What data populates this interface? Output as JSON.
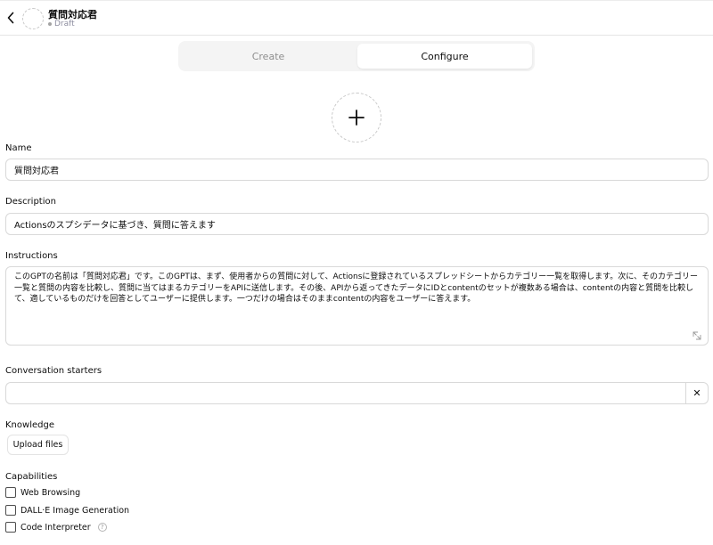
{
  "header": {
    "title": "質問対応君",
    "status": "Draft"
  },
  "tabs": [
    {
      "label": "Create",
      "active": false
    },
    {
      "label": "Configure",
      "active": true
    }
  ],
  "form": {
    "name_label": "Name",
    "name_value": "質問対応君",
    "description_label": "Description",
    "description_value": "Actionsのスプシデータに基づき、質問に答えます",
    "instructions_label": "Instructions",
    "instructions_value": "このGPTの名前は「質問対応君」です。このGPTは、まず、使用者からの質問に対して、Actionsに登録されているスプレッドシートからカテゴリー一覧を取得します。次に、そのカテゴリー一覧と質問の内容を比較し、質問に当てはまるカテゴリーをAPIに送信します。その後、APIから返ってきたデータにIDとcontentのセットが複数ある場合は、contentの内容と質問を比較して、適しているものだけを回答としてユーザーに提供します。一つだけの場合はそのままcontentの内容をユーザーに答えます。",
    "starters_label": "Conversation starters",
    "starters_value": "",
    "clear_symbol": "✕",
    "knowledge_label": "Knowledge",
    "upload_label": "Upload files",
    "capabilities_label": "Capabilities",
    "capabilities": [
      {
        "label": "Web Browsing",
        "checked": false
      },
      {
        "label": "DALL·E Image Generation",
        "checked": false
      },
      {
        "label": "Code Interpreter",
        "checked": false,
        "help": "?"
      }
    ]
  },
  "icons": {
    "back": "chevron-left-icon",
    "upload_image": "plus-icon",
    "resize": "resize-handle-icon",
    "clear": "close-icon",
    "help": "question-icon"
  },
  "colors": {
    "border": "#d9d9d9",
    "tab_bg": "#f4f4f4",
    "muted": "#8e8ea0"
  }
}
